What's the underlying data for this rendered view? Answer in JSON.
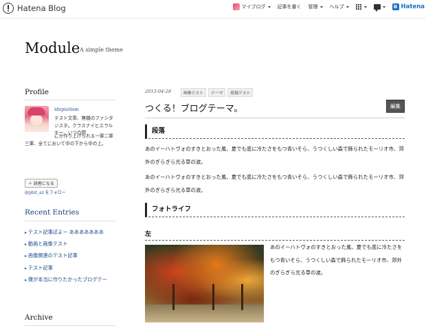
{
  "topbar": {
    "brand": "Hatena Blog",
    "menu": [
      {
        "label": "マイブログ",
        "caret": true,
        "icon": "avatar"
      },
      {
        "label": "記事を書く",
        "caret": false
      },
      {
        "label": "管理",
        "caret": true
      },
      {
        "label": "ヘルプ",
        "caret": true
      }
    ],
    "hatena_logo": "Hatena"
  },
  "header": {
    "title": "Module",
    "description": "A simple theme"
  },
  "sidebar": {
    "profile_title": "Profile",
    "profile_name": "idzpiutism",
    "profile_text_1": "テスト文章、無機のファンタジスタ。クラスナイヒエラルキー、いつの間",
    "profile_text_2": "にか作り上げられる一軍二軍三軍、全てにおいて中の下から中の上。",
    "follow_button": "読者になる",
    "follow_link": "@plut_az をフォロー",
    "recent_title": "Recent Entries",
    "recent_entries": [
      "テスト記事ぽよー あああああああ",
      "動画と画像テスト",
      "画像関連のテスト記事",
      "テスト記事",
      "僕が本当に作りたかったブログテー"
    ],
    "archive_title": "Archive"
  },
  "entry": {
    "date": "2013-04-28",
    "categories": [
      "画像テスト",
      "テーマ",
      "投稿テスト"
    ],
    "title": "つくる！ブログテーマ。",
    "edit_label": "編集",
    "section1_heading": "段落",
    "para1": "あのイーハトヴォのすきとおった風、夏でも底に冷たさをもつ青いそら、うつくしい森で飾られたモーリオ市、郊外のぎらぎら光る草の波。",
    "para2": "あのイーハトヴォのすきとおった風、夏でも底に冷たさをもつ青いそら、うつくしい森で飾られたモーリオ市、郊外のぎらぎら光る草の波。",
    "section2_heading": "フォトライフ",
    "left_heading": "左",
    "photo_caption_text": "あのイーハトヴォのすきとおった風、夏でも底に冷たさをもつ青いそら、うつくしい森で飾られたモーリオ市、郊外のぎらぎら光る草の波。"
  }
}
